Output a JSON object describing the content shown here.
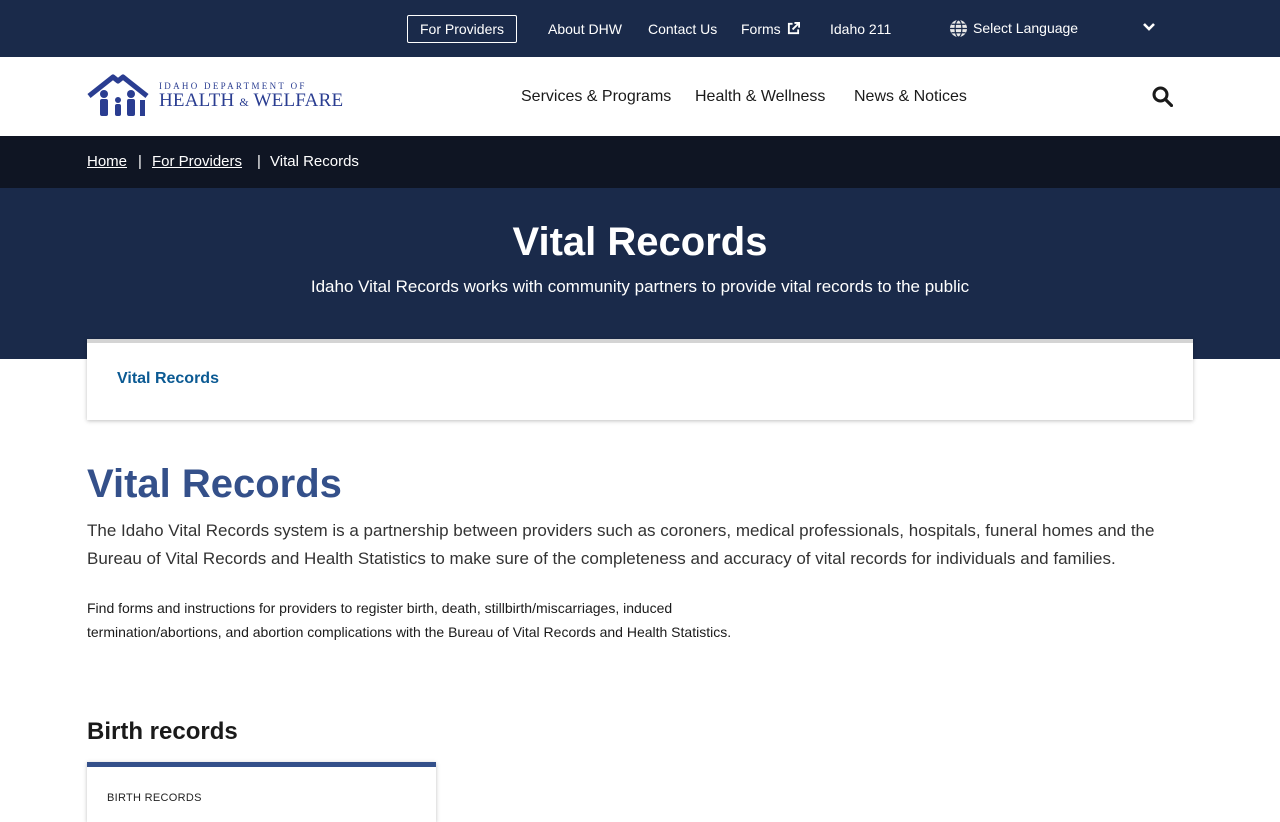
{
  "utility": {
    "for_providers": "For Providers",
    "links": [
      "About DHW",
      "Contact Us",
      "Forms",
      "Idaho 211"
    ],
    "language": "Select Language"
  },
  "logo": {
    "line1": "IDAHO DEPARTMENT OF",
    "health": "HEALTH",
    "amp": "&",
    "welfare": "WELFARE"
  },
  "nav": [
    "Services & Programs",
    "Health & Wellness",
    "News & Notices"
  ],
  "breadcrumb": {
    "home": "Home",
    "for_providers": "For Providers",
    "current": "Vital Records",
    "separator": "|"
  },
  "hero": {
    "title": "Vital Records",
    "subtitle": "Idaho Vital Records works with community partners to provide vital records to the public"
  },
  "subnav": {
    "link": "Vital Records"
  },
  "content": {
    "title": "Vital Records",
    "lead": "The Idaho Vital Records system is a partnership between providers such as coroners, medical professionals, hospitals, funeral homes and the Bureau of Vital Records and Health Statistics to make sure of the completeness and accuracy of vital records for individuals and families.",
    "paragraph": "Find forms and instructions for providers to register birth, death, stillbirth/miscarriages, induced termination/abortions, and abortion complications with the Bureau of Vital Records and Health Statistics.",
    "section_title": "Birth records",
    "card_label": "BIRTH RECORDS"
  },
  "colors": {
    "navy": "#1a2a4a",
    "breadcrumb_bg": "#0f1523",
    "title_blue": "#34508a",
    "link_blue": "#0b5a93",
    "logo_blue": "#2a3d91"
  },
  "icons": [
    "external-link-icon",
    "globe-icon",
    "chevron-down-icon",
    "search-icon"
  ]
}
